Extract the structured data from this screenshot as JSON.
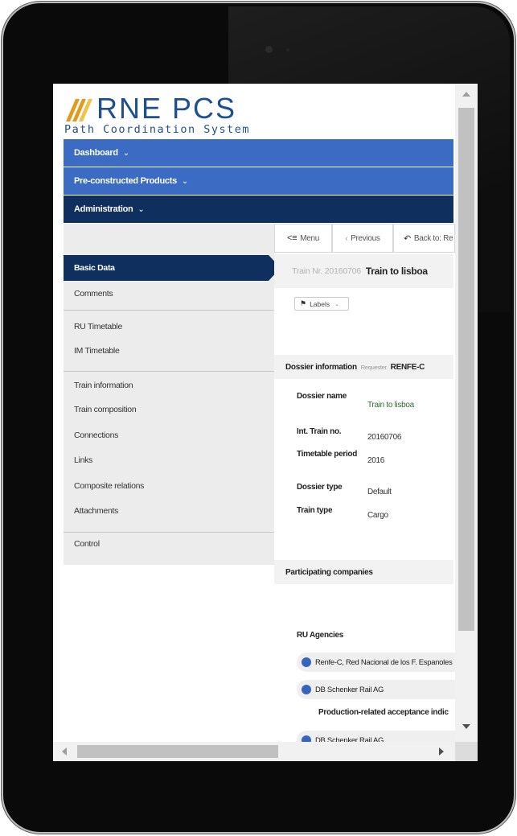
{
  "logo": {
    "brand_rne": "RNE",
    "brand_pcs": "PCS",
    "tagline": "Path Coordination System"
  },
  "nav": {
    "dashboard": "Dashboard",
    "pre_constructed": "Pre-constructed Products",
    "administration": "Administration"
  },
  "toolbar": {
    "menu": "Menu",
    "previous": "Previous",
    "back": "Back to: Re"
  },
  "sidebar": {
    "items": [
      "Basic Data",
      "Comments",
      "RU Timetable",
      "IM Timetable",
      "Train information",
      "Train composition",
      "Connections",
      "Links",
      "Composite relations",
      "Attachments",
      "Control"
    ]
  },
  "header": {
    "train_nr_label": "Train Nr. 20160706",
    "train_name": "Train to lisboa"
  },
  "labels_button": "Labels",
  "dossier": {
    "title": "Dossier information",
    "requester_label": "Requester",
    "requester_value": "RENFE-C",
    "fields": [
      {
        "key": "Dossier name",
        "value": "Train to lisboa"
      },
      {
        "key": "Int. Train no.",
        "value": "20160706"
      },
      {
        "key": "Timetable period",
        "value": "2016"
      },
      {
        "key": "Dossier type",
        "value": "Default"
      },
      {
        "key": "Train type",
        "value": "Cargo"
      }
    ]
  },
  "participating": {
    "title": "Participating companies",
    "ru_agencies": "RU Agencies",
    "companies": [
      "Renfe-C, Red Nacional de los F. Espanoles",
      "DB Schenker Rail AG"
    ],
    "acceptance_head": "Production-related acceptance indic",
    "acceptance_companies": [
      "DB Schenker Rail AG"
    ]
  },
  "colors": {
    "nav_light": "#3b6bc2",
    "nav_dark": "#0f2f5e",
    "brand": "#1d4f91",
    "accent_orange": "#e39a1c"
  }
}
